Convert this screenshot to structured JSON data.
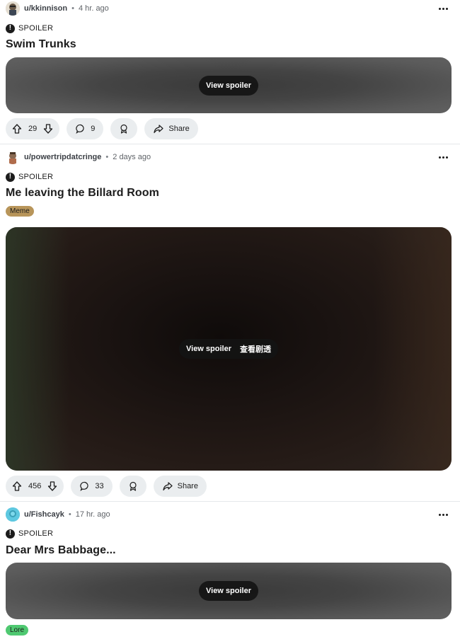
{
  "posts": [
    {
      "author": "u/kkinnison",
      "separator": "•",
      "time": "4 hr. ago",
      "spoiler_label": "SPOILER",
      "title": "Swim Trunks",
      "flair": null,
      "media": {
        "style": "gray",
        "buttons": [
          "View spoiler"
        ]
      },
      "votes": "29",
      "comments": "9",
      "share_label": "Share"
    },
    {
      "author": "u/powertripdatcringe",
      "separator": "•",
      "time": "2 days ago",
      "spoiler_label": "SPOILER",
      "title": "Me leaving the Billard Room",
      "flair": {
        "text": "Meme",
        "bg": "#b8955a",
        "color": "#1c1c1c"
      },
      "media": {
        "style": "dark",
        "buttons": [
          "View spoiler",
          "查看剧透"
        ]
      },
      "votes": "456",
      "comments": "33",
      "share_label": "Share"
    },
    {
      "author": "u/Fishcayk",
      "separator": "•",
      "time": "17 hr. ago",
      "spoiler_label": "SPOILER",
      "title": "Dear Mrs Babbage...",
      "flair": {
        "text": "Lore",
        "bg": "#4fc971",
        "color": "#1c1c1c"
      },
      "media": {
        "style": "gray",
        "buttons": [
          "View spoiler"
        ]
      }
    }
  ],
  "colors": {
    "pill_bg": "#eaedef",
    "divider": "#e5e8ea",
    "spoiler_overlay": "#141414"
  }
}
